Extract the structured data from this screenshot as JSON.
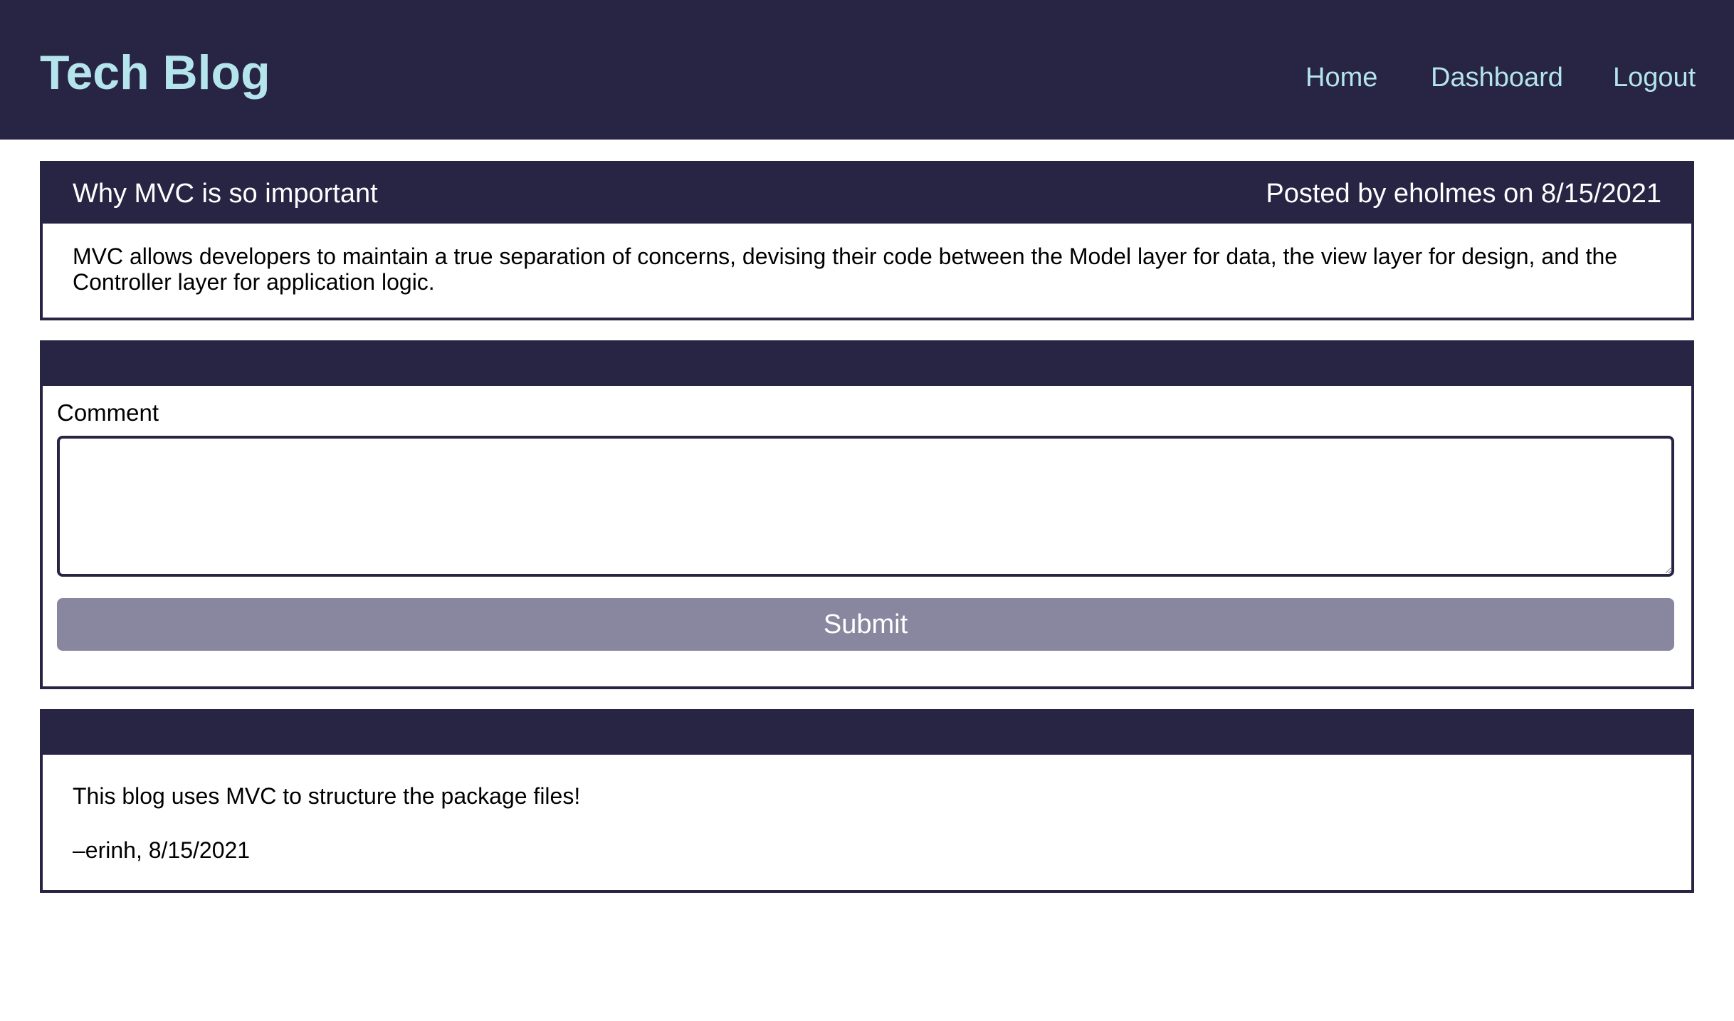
{
  "header": {
    "title": "Tech Blog",
    "nav": [
      {
        "label": "Home"
      },
      {
        "label": "Dashboard"
      },
      {
        "label": "Logout"
      }
    ]
  },
  "post": {
    "title": "Why MVC is so important",
    "meta": "Posted by eholmes on 8/15/2021",
    "body": "MVC allows developers to maintain a true separation of concerns, devising their code between the Model layer for data, the view layer for design, and the Controller layer for application logic."
  },
  "comment_form": {
    "label": "Comment",
    "textarea_value": "",
    "submit_label": "Submit"
  },
  "comments": [
    {
      "text": "This blog uses MVC to structure the package files!",
      "byline": "–erinh, 8/15/2021"
    }
  ],
  "colors": {
    "navy": "#272444",
    "accent_text": "#b4e4ec",
    "button": "#89879f",
    "white": "#ffffff"
  }
}
